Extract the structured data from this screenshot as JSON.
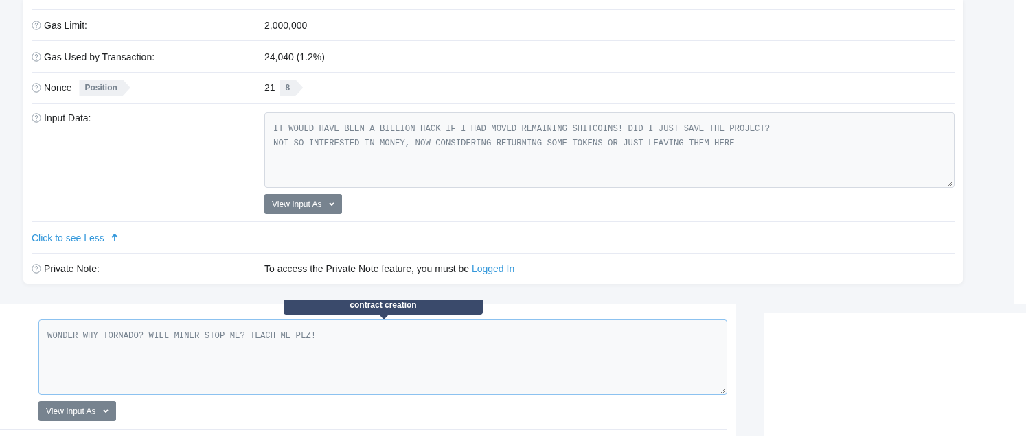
{
  "details": {
    "rows": [
      {
        "kind": "field",
        "label": "Gas Limit:",
        "value": "2,000,000"
      },
      {
        "kind": "field",
        "label": "Gas Used by Transaction:",
        "value": "24,040 (1.2%)"
      },
      {
        "kind": "nonce",
        "label": "Nonce",
        "label_tag": "Position",
        "value": "21",
        "value_tag": "8"
      },
      {
        "kind": "input",
        "label": "Input Data:",
        "input_lines": [
          "IT WOULD HAVE BEEN A BILLION HACK IF I HAD MOVED REMAINING SHITCOINS! DID I JUST SAVE THE PROJECT?",
          "NOT SO INTERESTED IN MONEY, NOW CONSIDERING RETURNING SOME TOKENS OR JUST LEAVING THEM HERE"
        ],
        "button": "View Input As"
      },
      {
        "kind": "toggle",
        "link": "Click to see Less"
      },
      {
        "kind": "note",
        "label": "Private Note:",
        "text": "To access the Private Note feature, you must be",
        "link": "Logged In"
      }
    ]
  },
  "second_panel": {
    "tooltip": "contract creation",
    "input_lines": [
      "WONDER WHY TORNADO? WILL MINER STOP ME? TEACH ME PLZ!"
    ],
    "button": "View Input As"
  }
}
